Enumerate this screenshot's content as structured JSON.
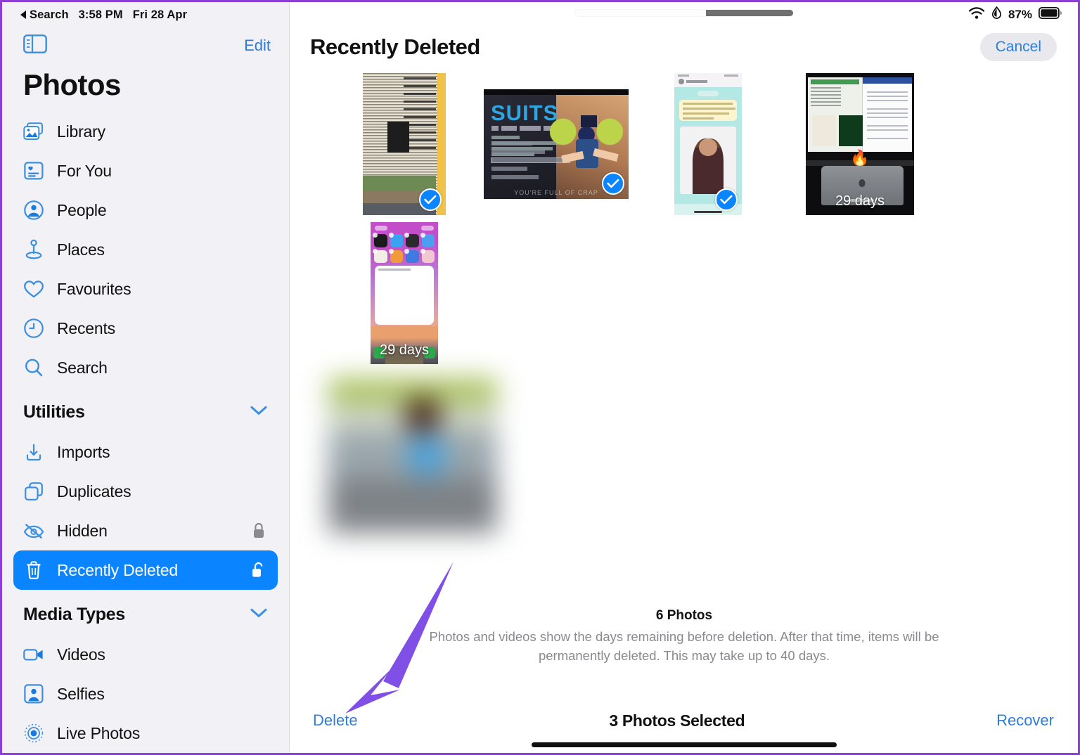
{
  "status_bar": {
    "back_label": "Search",
    "time": "3:58 PM",
    "date": "Fri 28 Apr",
    "battery_percent": "87%",
    "wifi_icon": "wifi-icon",
    "low_power_icon": "battery-saver-drop-icon",
    "battery_icon": "battery-icon"
  },
  "sidebar": {
    "toggle_icon": "sidebar-toggle-icon",
    "edit_label": "Edit",
    "title": "Photos",
    "items": [
      {
        "label": "Library",
        "icon": "photo-stack-icon"
      },
      {
        "label": "For You",
        "icon": "for-you-card-icon"
      },
      {
        "label": "People",
        "icon": "person-circle-icon"
      },
      {
        "label": "Places",
        "icon": "map-pin-icon"
      },
      {
        "label": "Favourites",
        "icon": "heart-icon"
      },
      {
        "label": "Recents",
        "icon": "clock-icon"
      },
      {
        "label": "Search",
        "icon": "magnifier-icon"
      }
    ],
    "groups": [
      {
        "title": "Utilities",
        "chevron_icon": "chevron-down-icon",
        "items": [
          {
            "label": "Imports",
            "icon": "import-tray-icon",
            "trailing_icon": ""
          },
          {
            "label": "Duplicates",
            "icon": "duplicate-squares-icon",
            "trailing_icon": ""
          },
          {
            "label": "Hidden",
            "icon": "eye-slash-icon",
            "trailing_icon": "lock-closed-icon"
          },
          {
            "label": "Recently Deleted",
            "icon": "trash-icon",
            "trailing_icon": "lock-open-icon",
            "selected": true
          }
        ]
      },
      {
        "title": "Media Types",
        "chevron_icon": "chevron-down-icon",
        "items": [
          {
            "label": "Videos",
            "icon": "video-camera-icon",
            "trailing_icon": ""
          },
          {
            "label": "Selfies",
            "icon": "selfie-portrait-icon",
            "trailing_icon": ""
          },
          {
            "label": "Live Photos",
            "icon": "live-photo-icon",
            "trailing_icon": ""
          }
        ]
      }
    ]
  },
  "content": {
    "title": "Recently Deleted",
    "cancel_label": "Cancel",
    "multitask_handle_icon": "split-view-handle-icon",
    "photos": [
      {
        "name": "newspaper-clipping",
        "selected": true,
        "days_remaining": ""
      },
      {
        "name": "netflix-suits-screenshot",
        "selected": true,
        "days_remaining": "",
        "overlay_text": "SUITS",
        "caption": "YOU'RE FULL OF CRAP"
      },
      {
        "name": "whatsapp-chat-screenshot",
        "selected": true,
        "days_remaining": ""
      },
      {
        "name": "desk-monitor-photo",
        "selected": false,
        "days_remaining": "29 days"
      },
      {
        "name": "ios-home-screen-shot",
        "selected": false,
        "days_remaining": "29 days"
      },
      {
        "name": "blurred-people-photo",
        "selected": false,
        "days_remaining": ""
      }
    ],
    "footer": {
      "count": "6 Photos",
      "description": "Photos and videos show the days remaining before deletion. After that time, items will be permanently deleted. This may take up to 40 days."
    },
    "toolbar": {
      "delete_label": "Delete",
      "selection_label": "3 Photos Selected",
      "recover_label": "Recover"
    }
  },
  "annotation": {
    "arrow_icon": "callout-arrow-icon",
    "arrow_color": "#7f4fe6",
    "points_to": "Delete"
  },
  "colors": {
    "accent_blue": "#0b84ff",
    "link_blue": "#2e7ddb",
    "sidebar_bg": "#f2f1f6",
    "frame_purple": "#8d3fd4",
    "muted_text": "#8a8a8e"
  }
}
